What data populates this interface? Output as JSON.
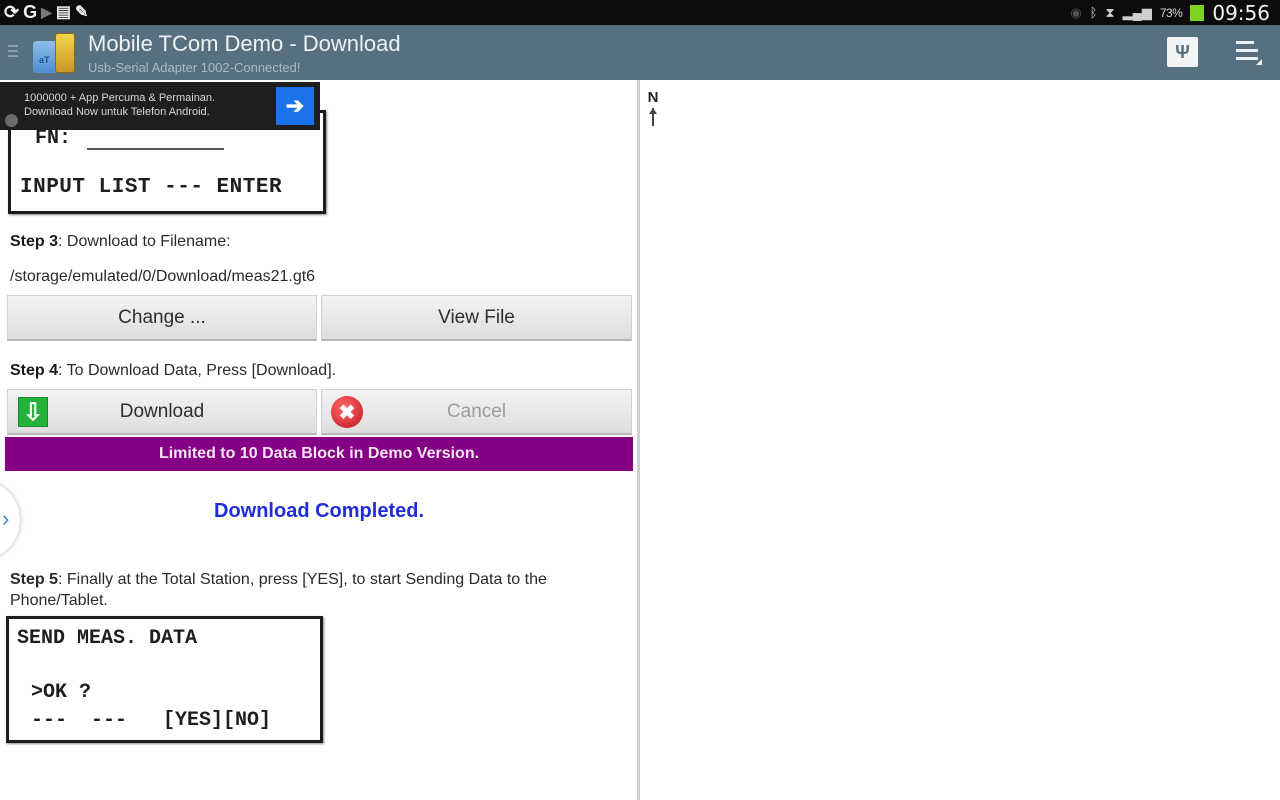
{
  "status_bar": {
    "left_icons": [
      "sync-icon",
      "google-icon",
      "play-icon",
      "clipboard-icon",
      "edit-icon"
    ],
    "right_icons": [
      "eye-icon",
      "bluetooth-icon",
      "wifi-icon",
      "signal-icon"
    ],
    "battery_percent": "73%",
    "battery_color": "#7cd320",
    "time": "09:56"
  },
  "action_bar": {
    "title": "Mobile TCom Demo - Download",
    "subtitle": "Usb-Serial Adapter 1002-Connected!",
    "app_icon_label": "aT",
    "usb_button_icon": "usb-icon",
    "menu_button_icon": "overflow-menu-icon",
    "background_color": "#56707f"
  },
  "ad": {
    "line1": "1000000 + App Percuma & Permainan.",
    "line2": "Download Now untuk Telefon Android.",
    "go_icon": "➔"
  },
  "lcd_top": {
    "fn_label": "FN:",
    "line": "INPUT LIST --- ENTER"
  },
  "step3": {
    "label": "Step 3",
    "text": ": Download to Filename:",
    "path": "/storage/emulated/0/Download/meas21.gt6"
  },
  "buttons": {
    "change": "Change ...",
    "view_file": "View File",
    "download": "Download",
    "cancel": "Cancel",
    "download_icon": "⇩",
    "cancel_icon": "✖"
  },
  "step4": {
    "label": "Step 4",
    "text": ": To Download Data, Press [Download]."
  },
  "demo_notice": {
    "text": "Limited to 10 Data Block in Demo Version.",
    "color": "#860086"
  },
  "download_status": {
    "text": "Download Completed.",
    "color": "#1f2ed6"
  },
  "side_tab": {
    "chevron": "›"
  },
  "step5": {
    "label": "Step 5",
    "text": ": Finally at the Total Station, press [YES], to start Sending Data to the Phone/Tablet."
  },
  "lcd_bottom": {
    "line1": "SEND MEAS. DATA",
    "line2": ">OK ?",
    "line3": "---  ---   [YES][NO]"
  },
  "map_pane": {
    "north_label": "N"
  }
}
